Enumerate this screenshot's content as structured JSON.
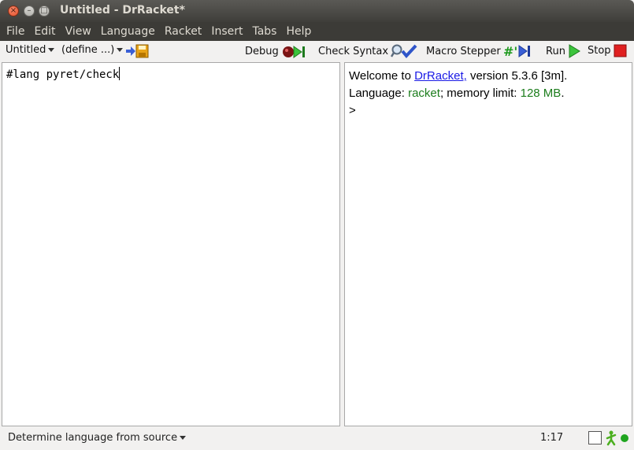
{
  "window": {
    "title": "Untitled - DrRacket*"
  },
  "menu": [
    "File",
    "Edit",
    "View",
    "Language",
    "Racket",
    "Insert",
    "Tabs",
    "Help"
  ],
  "toolbar": {
    "file_menu": "Untitled",
    "define_menu": "(define ...)",
    "debug": "Debug",
    "check_syntax": "Check Syntax",
    "macro_stepper": "Macro Stepper",
    "run": "Run",
    "stop": "Stop"
  },
  "editor": {
    "code": "#lang pyret/check"
  },
  "repl": {
    "welcome_prefix": "Welcome to ",
    "welcome_link": "DrRacket,",
    "welcome_suffix": " version 5.3.6 [3m].",
    "lang_prefix": "Language: ",
    "lang_name": "racket",
    "mem_prefix": "; memory limit: ",
    "mem_value": "128 MB",
    "mem_suffix": ".",
    "prompt": ">"
  },
  "status": {
    "language": "Determine language from source",
    "position": "1:17"
  },
  "colors": {
    "accent_green": "#1c7d1c",
    "link": "#1a1ae6",
    "stop_red": "#e02020"
  },
  "icons": [
    "close-icon",
    "minimize-icon",
    "maximize-icon",
    "save-icon",
    "debug-icon",
    "check-syntax-icon",
    "macro-stepper-icon",
    "run-icon",
    "stop-icon",
    "gc-walker-icon",
    "status-dot-icon"
  ]
}
